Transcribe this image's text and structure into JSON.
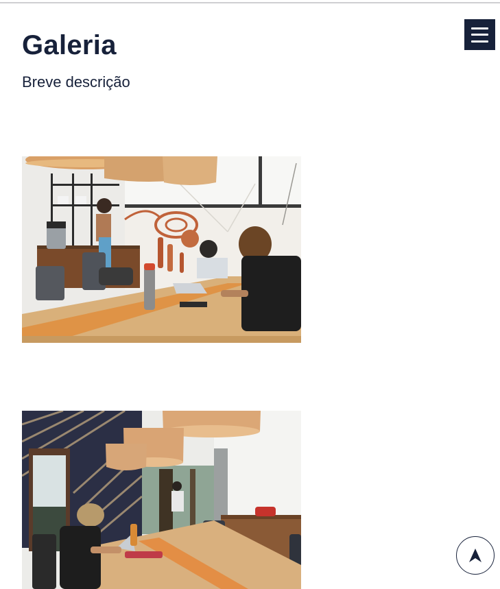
{
  "header": {
    "menu_icon": "hamburger-menu-icon",
    "menu_button_color": "#17213a"
  },
  "gallery": {
    "title": "Galeria",
    "subtitle": "Breve descrição",
    "images": [
      {
        "subject": "coworking space with wicker pendant lamps, long wooden table, people working on laptops"
      },
      {
        "subject": "coworking room with striped wood wall panels, wicker pendant lamps, man writing at long table"
      }
    ]
  },
  "scroll_top": {
    "icon": "arrow-up-icon"
  },
  "colors": {
    "primary": "#17213a",
    "background": "#ffffff",
    "divider": "#cfcfd2"
  }
}
